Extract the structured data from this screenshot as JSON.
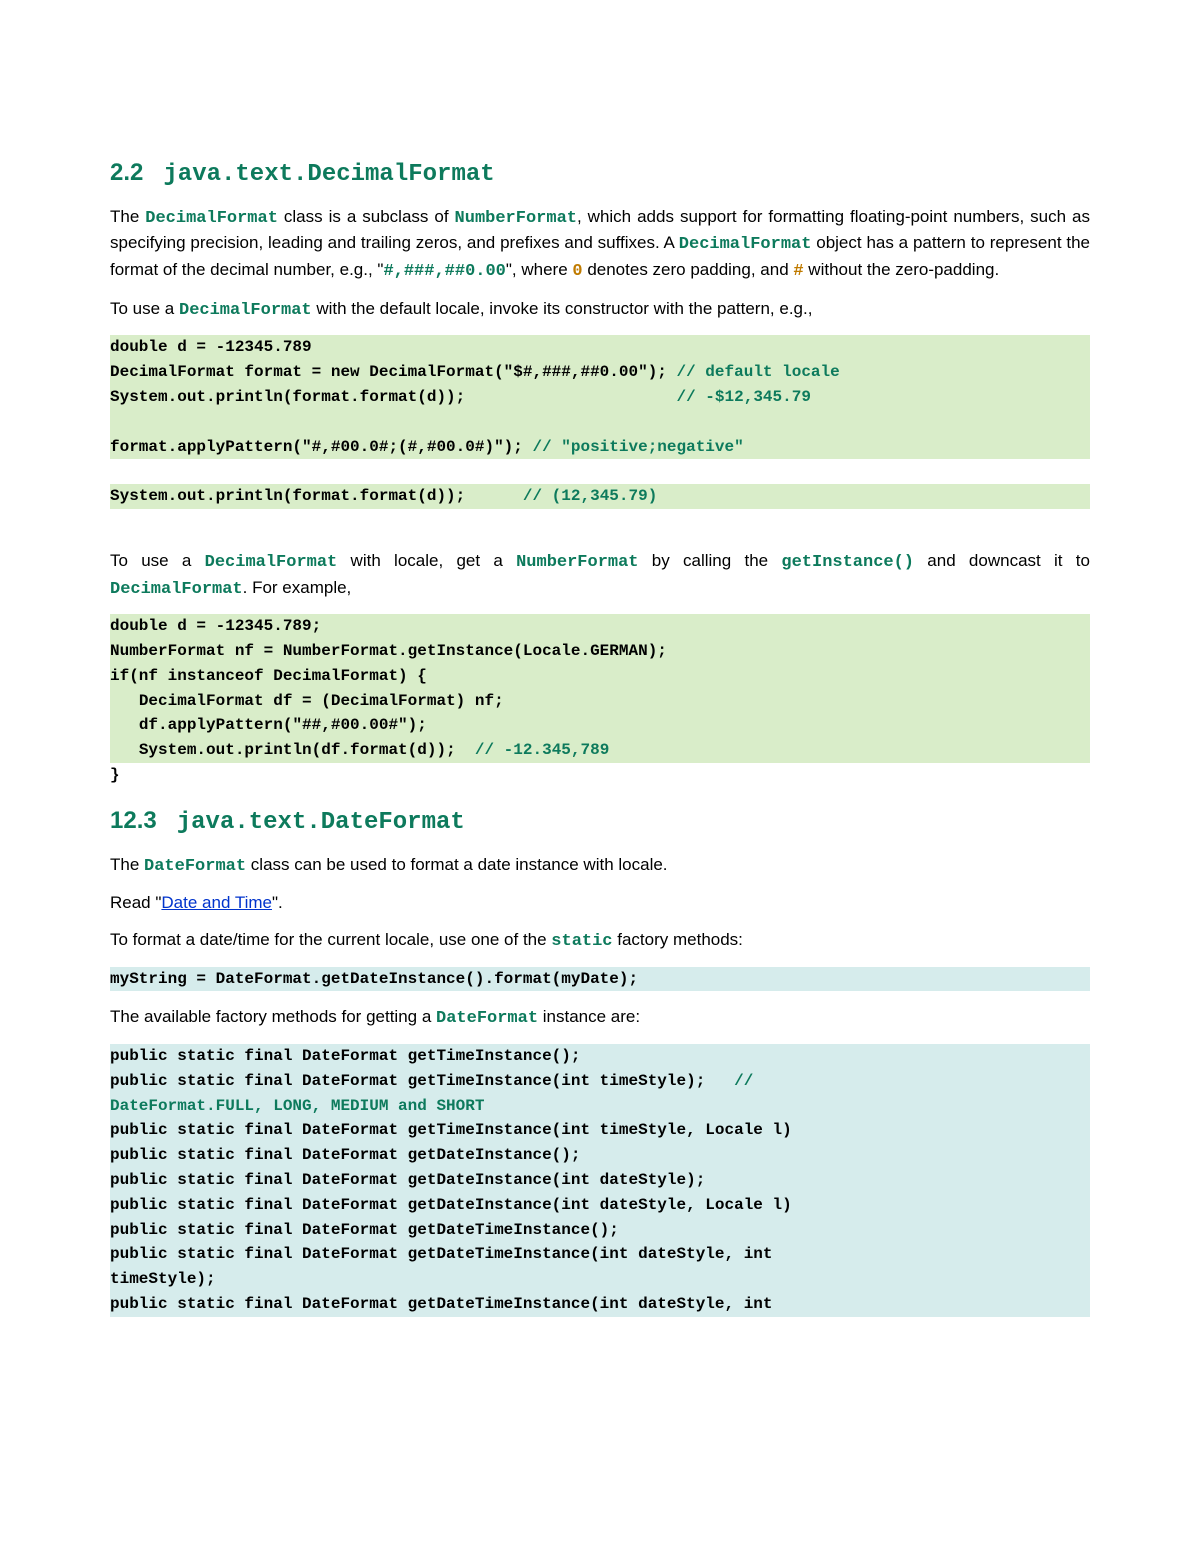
{
  "section1": {
    "number": "2.2",
    "title": "java.text.DecimalFormat",
    "para1": {
      "t1": "The ",
      "c1": "DecimalFormat",
      "t2": " class is a subclass of ",
      "c2": "NumberFormat",
      "t3": ", which adds support for formatting floating-point numbers, such as specifying precision, leading and trailing zeros, and prefixes and suffixes. A ",
      "c3": "DecimalFormat",
      "t4": " object has a pattern to represent the format of the decimal number, e.g., \"",
      "p1": "#,###,##0.00",
      "t5": "\", where ",
      "h1": "0",
      "t6": " denotes zero padding, and ",
      "h2": "#",
      "t7": " without the zero-padding."
    },
    "para2": {
      "t1": "To use a ",
      "c1": "DecimalFormat",
      "t2": " with the default locale, invoke its constructor with the pattern, e.g.,"
    },
    "code1": {
      "l1": "double d = -12345.789",
      "l2a": "DecimalFormat format = new DecimalFormat(\"$#,###,##0.00\"); ",
      "l2b": "// default locale",
      "l3a": "System.out.println(format.format(d));                      ",
      "l3b": "// -$12,345.79",
      "l4": " ",
      "l5a": "format.applyPattern(\"#,#00.0#;(#,#00.0#)\"); ",
      "l5b": "// \"positive;negative\"",
      "l6": "",
      "l7a": "System.out.println(format.format(d));      ",
      "l7b": "// (12,345.79)"
    },
    "para3": {
      "t1": "To use a ",
      "c1": "DecimalFormat",
      "t2": " with locale, get a ",
      "c2": "NumberFormat",
      "t3": " by calling the ",
      "c3": "getInstance()",
      "t4": " and downcast it to ",
      "c4": "DecimalFormat",
      "t5": ". For example,"
    },
    "code2": {
      "l1": "double d = -12345.789;",
      "l2": "NumberFormat nf = NumberFormat.getInstance(Locale.GERMAN);",
      "l3": "if(nf instanceof DecimalFormat) {",
      "l4": "   DecimalFormat df = (DecimalFormat) nf;",
      "l5": "   df.applyPattern(\"##,#00.00#\");",
      "l6a": "   System.out.println(df.format(d));  ",
      "l6b": "// -12.345,789",
      "l7": "}"
    }
  },
  "section2": {
    "number": "12.3",
    "title": "java.text.DateFormat",
    "para1": {
      "t1": "The ",
      "c1": "DateFormat",
      "t2": " class can be used to format a date instance with locale."
    },
    "para2": {
      "t1": "Read \"",
      "link": "Date and Time",
      "t2": "\"."
    },
    "para3": {
      "t1": "To format a date/time for the current locale, use one of the ",
      "c1": "static",
      "t2": " factory methods:"
    },
    "code3": {
      "l1": "myString = DateFormat.getDateInstance().format(myDate);"
    },
    "para4": {
      "t1": "The available factory methods for getting a ",
      "c1": "DateFormat",
      "t2": " instance are:"
    },
    "code4": {
      "l1": "public static final DateFormat getTimeInstance();",
      "l2a": "public static final DateFormat getTimeInstance(int timeStyle);   ",
      "l2b": "//",
      "l2c": "DateFormat.FULL, LONG, MEDIUM and SHORT",
      "l3": "public static final DateFormat getTimeInstance(int timeStyle, Locale l)",
      "l4": "public static final DateFormat getDateInstance();",
      "l5": "public static final DateFormat getDateInstance(int dateStyle);",
      "l6": "public static final DateFormat getDateInstance(int dateStyle, Locale l)",
      "l7": "public static final DateFormat getDateTimeInstance();",
      "l8": "public static final DateFormat getDateTimeInstance(int dateStyle, int",
      "l8b": "timeStyle);",
      "l9": "public static final DateFormat getDateTimeInstance(int dateStyle, int"
    }
  }
}
